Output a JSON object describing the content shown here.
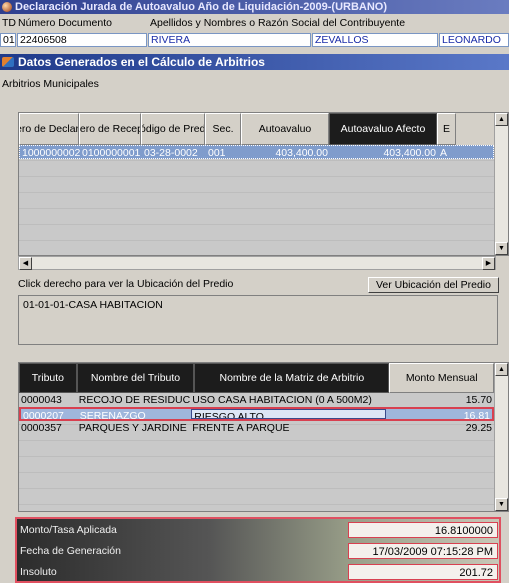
{
  "window": {
    "title": "Declaración Jurada de Autoavaluo Año de Liquidación-2009-(URBANO)"
  },
  "header": {
    "td_label": "TD",
    "doc_label": "Número Documento",
    "name_label": "Apellidos y Nombres o Razón Social del Contribuyente",
    "td_value": "01",
    "doc_value": "22406508",
    "name1": "RIVERA",
    "name2": "ZEVALLOS",
    "name3": "LEONARDO"
  },
  "section": {
    "title": "Datos Generados en el Cálculo de Arbitrios"
  },
  "group": {
    "label": "Arbitrios Municipales"
  },
  "grid1": {
    "columns": [
      "Número de Declaración",
      "Número de Recepción",
      "Código de Predio",
      "Sec.",
      "Autoavaluo",
      "Autoavaluo Afecto",
      "E"
    ],
    "rows": [
      [
        "1000000002",
        "0100000001",
        "03-28-0002",
        "001",
        "403,400.00",
        "403,400.00",
        "A"
      ]
    ]
  },
  "hint": {
    "text": "Click derecho para ver la Ubicación del Predio"
  },
  "buttons": {
    "ver_ubicacion": "Ver Ubicación del Predio"
  },
  "memo": {
    "text": "01-01-01-CASA HABITACION"
  },
  "grid2": {
    "columns": [
      "Tributo",
      "Nombre del Tributo",
      "Nombre de la Matriz de Arbitrio",
      "Monto Mensual"
    ],
    "rows": [
      [
        "0000043",
        "RECOJO DE RESIDUC",
        "USO CASA HABITACION (0 A 500M2)",
        "15.70"
      ],
      [
        "0000207",
        "SERENAZGO",
        "RIESGO ALTO",
        "16.81"
      ],
      [
        "0000357",
        "PARQUES Y JARDINE",
        "FRENTE A PARQUE",
        "29.25"
      ]
    ]
  },
  "footer": {
    "tasa_label": "Monto/Tasa Aplicada",
    "tasa_value": "16.8100000",
    "fecha_label": "Fecha de Generación",
    "fecha_value": "17/03/2009 07:15:28 PM",
    "insoluto_label": "Insoluto",
    "insoluto_value": "201.72"
  },
  "colors": {
    "accent_outline": "#e05060",
    "selection": "#7f9ccc",
    "title_bar": "#1f3a8a"
  }
}
